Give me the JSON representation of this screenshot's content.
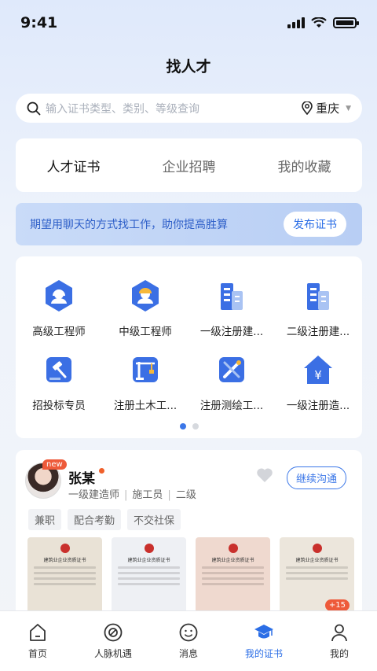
{
  "status_bar": {
    "time": "9:41"
  },
  "page_title": "找人才",
  "search": {
    "placeholder": "输入证书类型、类别、等级查询",
    "location": "重庆"
  },
  "tabs": [
    {
      "label": "人才证书",
      "active": true
    },
    {
      "label": "企业招聘",
      "active": false
    },
    {
      "label": "我的收藏",
      "active": false
    }
  ],
  "banner": {
    "text": "期望用聊天的方式找工作，助你提高胜算",
    "button": "发布证书"
  },
  "categories": [
    {
      "label": "高级工程师",
      "icon": "engineer-icon"
    },
    {
      "label": "中级工程师",
      "icon": "engineer-icon"
    },
    {
      "label": "一级注册建...",
      "icon": "building-icon"
    },
    {
      "label": "二级注册建...",
      "icon": "building-icon"
    },
    {
      "label": "招投标专员",
      "icon": "gavel-icon"
    },
    {
      "label": "注册土木工...",
      "icon": "crane-icon"
    },
    {
      "label": "注册测绘工...",
      "icon": "survey-icon"
    },
    {
      "label": "一级注册造...",
      "icon": "cost-house-icon"
    }
  ],
  "carousel": {
    "page": 1,
    "total": 2
  },
  "talent": {
    "badge": "new",
    "name": "张某",
    "meta": [
      "一级建造师",
      "施工员",
      "二级"
    ],
    "action": "继续沟通",
    "tags": [
      "兼职",
      "配合考勤",
      "不交社保"
    ],
    "more_count": "+15",
    "cert_titles": [
      "建筑业企业资质证书",
      "建筑业企业资质证书",
      "建筑业企业资质证书",
      "建筑业企业资质证书"
    ]
  },
  "tabbar": [
    {
      "label": "首页",
      "icon": "home-icon",
      "active": false
    },
    {
      "label": "人脉机遇",
      "icon": "compass-icon",
      "active": false
    },
    {
      "label": "消息",
      "icon": "message-icon",
      "active": false
    },
    {
      "label": "我的证书",
      "icon": "graduation-cap-icon",
      "active": true
    },
    {
      "label": "我的",
      "icon": "user-icon",
      "active": false
    }
  ],
  "colors": {
    "accent": "#2b6ee6",
    "badge": "#ee5a3a"
  }
}
